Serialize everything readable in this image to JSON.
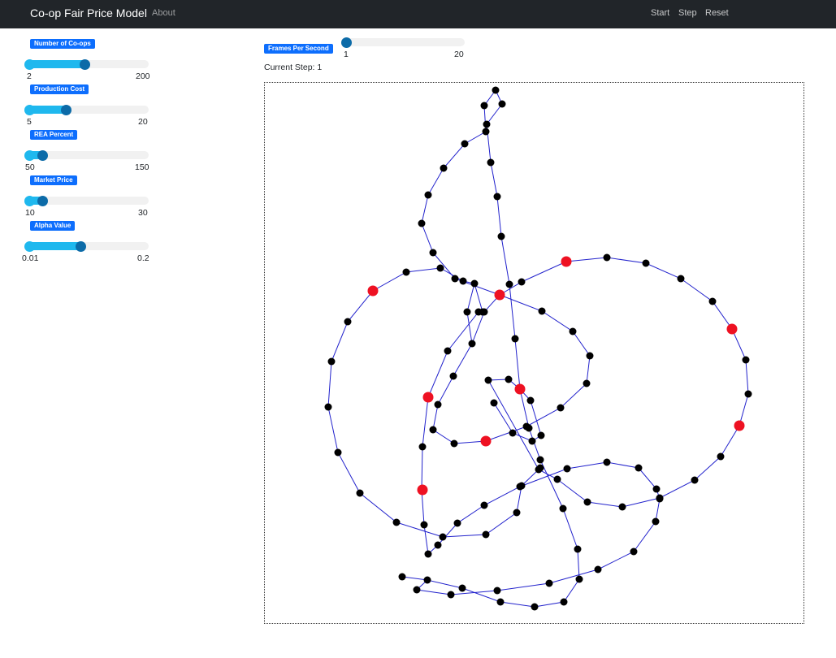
{
  "navbar": {
    "brand": "Co-op Fair Price Model",
    "about": "About",
    "start": "Start",
    "step": "Step",
    "reset": "Reset"
  },
  "sliders": [
    {
      "label": "Number of Co-ops",
      "min": "2",
      "max": "200",
      "fraction": 0.48
    },
    {
      "label": "Production Cost",
      "min": "5",
      "max": "20",
      "fraction": 0.33
    },
    {
      "label": "REA Percent",
      "min": "50",
      "max": "150",
      "fraction": 0.14
    },
    {
      "label": "Market Price",
      "min": "10",
      "max": "30",
      "fraction": 0.14
    },
    {
      "label": "Alpha Value",
      "min": "0.01",
      "max": "0.2",
      "fraction": 0.45
    }
  ],
  "fps": {
    "label": "Frames Per Second",
    "min": "1",
    "max": "20",
    "fraction": 0.0
  },
  "status": {
    "current_step": "Current Step: 1"
  },
  "colors": {
    "badge": "#0d6efd",
    "slider_fill": "#1fb8ee",
    "slider_knob": "#0c6ba8",
    "edge": "#2222cc",
    "node": "#000000",
    "highlight_node": "#ee1122"
  }
}
